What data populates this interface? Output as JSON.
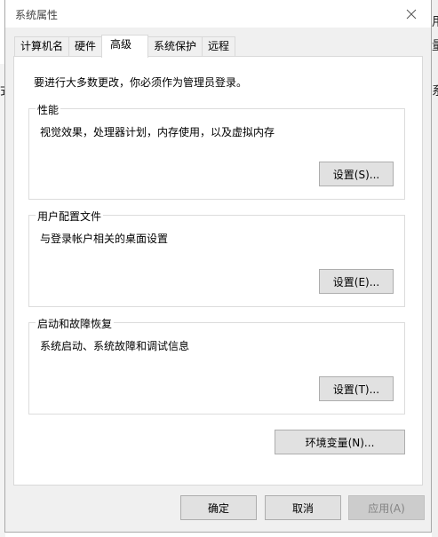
{
  "window": {
    "title": "系统属性"
  },
  "background_glimpses": {
    "left_char": "式",
    "right_chars": [
      "用",
      "量",
      "系"
    ]
  },
  "tabs": [
    {
      "label": "计算机名",
      "active": false
    },
    {
      "label": "硬件",
      "active": false
    },
    {
      "label": "高级",
      "active": true
    },
    {
      "label": "系统保护",
      "active": false
    },
    {
      "label": "远程",
      "active": false
    }
  ],
  "advanced": {
    "admin_note": "要进行大多数更改，你必须作为管理员登录。",
    "performance": {
      "title": "性能",
      "description": "视觉效果，处理器计划，内存使用，以及虚拟内存",
      "button": "设置(S)..."
    },
    "user_profiles": {
      "title": "用户配置文件",
      "description": "与登录帐户相关的桌面设置",
      "button": "设置(E)..."
    },
    "startup_recovery": {
      "title": "启动和故障恢复",
      "description": "系统启动、系统故障和调试信息",
      "button": "设置(T)..."
    },
    "env_button": "环境变量(N)..."
  },
  "footer": {
    "ok": "确定",
    "cancel": "取消",
    "apply": "应用(A)"
  },
  "icons": {
    "close": "close-icon"
  }
}
